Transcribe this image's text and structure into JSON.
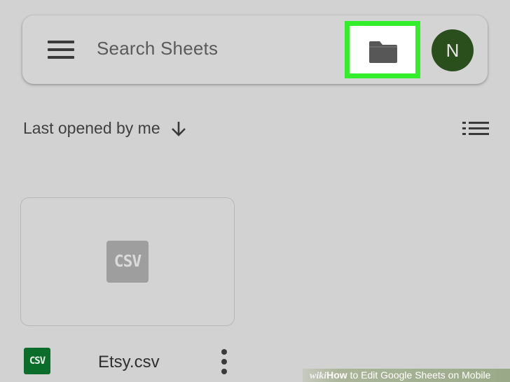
{
  "search_bar": {
    "placeholder": "Search Sheets",
    "avatar_initial": "N",
    "avatar_color": "#2a4e1c",
    "highlight_color": "#33ee2a",
    "icons": [
      "menu-icon",
      "folder-icon"
    ]
  },
  "sort": {
    "label": "Last opened by me",
    "direction_icon": "arrow-down-icon",
    "view_toggle_icon": "list-view-icon"
  },
  "files": [
    {
      "name": "Etsy.csv",
      "type_label": "CSV",
      "thumbnail_label": "CSV",
      "badge_color": "#0a6e2a"
    }
  ],
  "watermark": {
    "brand_prefix": "wiki",
    "brand_suffix": "How",
    "title": " to Edit Google Sheets on Mobile"
  }
}
